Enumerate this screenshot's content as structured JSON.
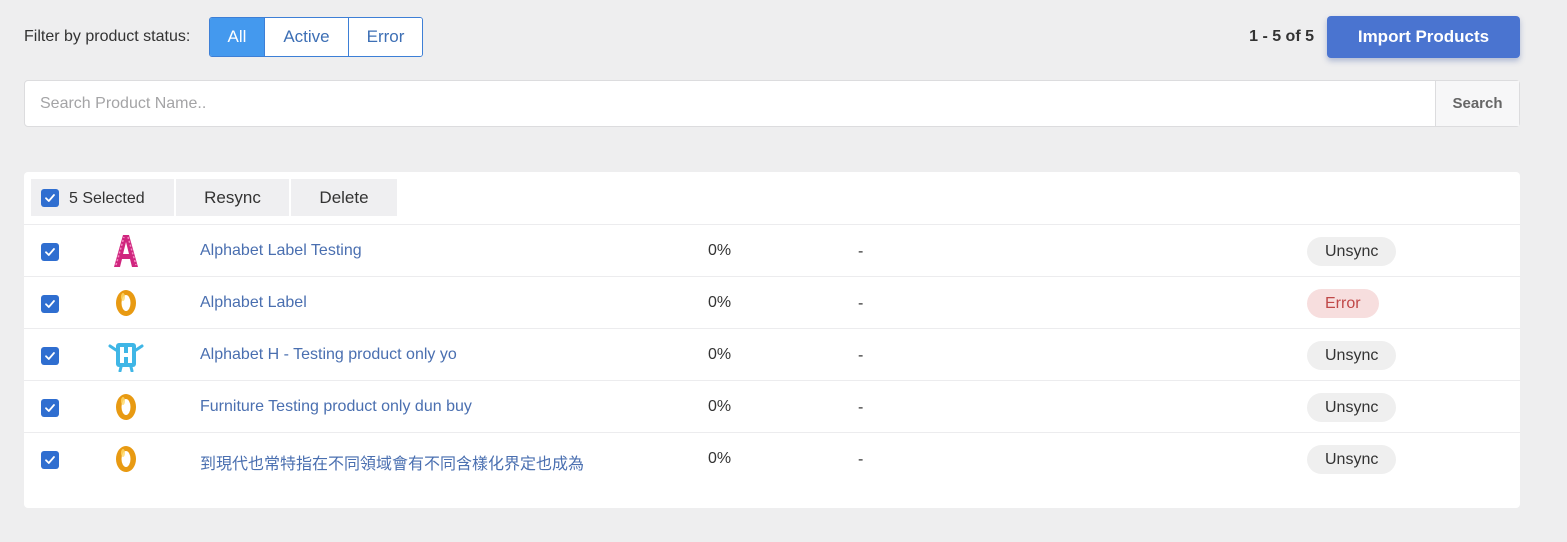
{
  "filter": {
    "label": "Filter by product status:",
    "options": [
      {
        "label": "All",
        "active": true
      },
      {
        "label": "Active",
        "active": false
      },
      {
        "label": "Error",
        "active": false
      }
    ]
  },
  "pagination": {
    "text": "1 - 5 of 5"
  },
  "import_button": {
    "label": "Import Products"
  },
  "search": {
    "placeholder": "Search Product Name..",
    "value": "",
    "button_label": "Search"
  },
  "bulk": {
    "selected_label": "5 Selected",
    "checked": true,
    "resync_label": "Resync",
    "delete_label": "Delete"
  },
  "products": [
    {
      "checked": true,
      "thumb": "letter-a-icon",
      "name": "Alphabet Label Testing",
      "progress": "0%",
      "extra": "-",
      "status": "Unsync",
      "status_type": "neutral"
    },
    {
      "checked": true,
      "thumb": "number-zero-icon",
      "name": "Alphabet Label",
      "progress": "0%",
      "extra": "-",
      "status": "Error",
      "status_type": "error"
    },
    {
      "checked": true,
      "thumb": "letter-h-icon",
      "name": "Alphabet H - Testing product only yo",
      "progress": "0%",
      "extra": "-",
      "status": "Unsync",
      "status_type": "neutral"
    },
    {
      "checked": true,
      "thumb": "number-zero-icon",
      "name": "Furniture Testing product only dun buy",
      "progress": "0%",
      "extra": "-",
      "status": "Unsync",
      "status_type": "neutral"
    },
    {
      "checked": true,
      "thumb": "number-zero-icon",
      "name": "到現代也常特指在不同領域會有不同含樣化界定也成為",
      "progress": "0%",
      "extra": "-",
      "status": "Unsync",
      "status_type": "neutral"
    }
  ],
  "colors": {
    "accent": "#4499ee",
    "primary_button": "#4a74d0",
    "checkbox": "#2f6ed0",
    "link": "#4a6fb0",
    "error_badge_bg": "#f7dede",
    "error_badge_text": "#c04848"
  }
}
